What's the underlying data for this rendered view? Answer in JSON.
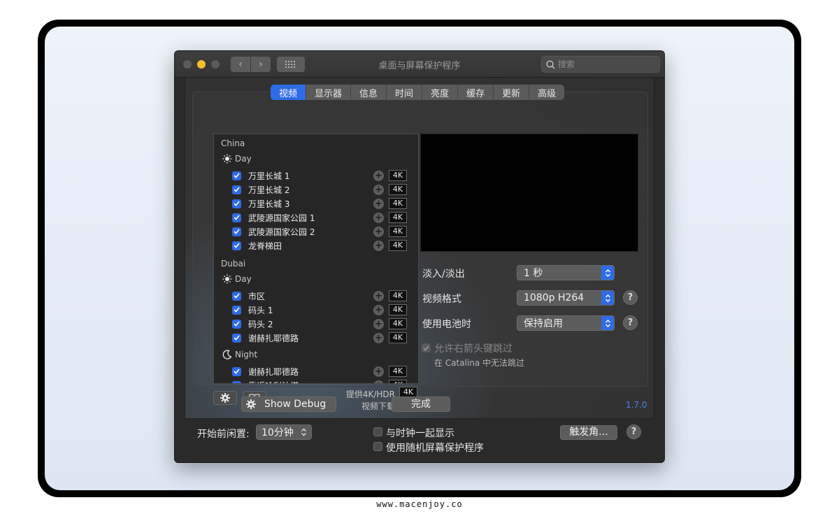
{
  "watermark": "www.macenjoy.co",
  "window": {
    "title": "桌面与屏幕保护程序",
    "nav_back": "‹",
    "nav_forward": "›",
    "search_placeholder": "搜索"
  },
  "tabs": [
    "视频",
    "显示器",
    "信息",
    "时间",
    "亮度",
    "缓存",
    "更新",
    "高级"
  ],
  "active_tab": "视频",
  "video_list": {
    "groups": [
      {
        "city": "China",
        "periods": [
          {
            "period": "Day",
            "items": [
              "万里长城 1",
              "万里长城 2",
              "万里长城 3",
              "武陵源国家公园 1",
              "武陵源国家公园 2",
              "龙脊梯田"
            ]
          }
        ]
      },
      {
        "city": "Dubai",
        "periods": [
          {
            "period": "Day",
            "items": [
              "市区",
              "码头 1",
              "码头 2",
              "谢赫扎耶德路"
            ]
          },
          {
            "period": "Night",
            "items": [
              "谢赫扎耶德路",
              "靠近哈利法塔"
            ]
          }
        ]
      }
    ],
    "badge": "4K"
  },
  "provide_4k_line1": "提供4K/HDR",
  "provide_4k_line2": "视频下载",
  "provide_4k_badge": "4K",
  "settings": {
    "fade_label": "淡入/淡出",
    "fade_value": "1 秒",
    "format_label": "视频格式",
    "format_value": "1080p H264",
    "battery_label": "使用电池时",
    "battery_value": "保持启用",
    "help": "?",
    "skip_label": "允许右箭头键跳过",
    "skip_note": "在 Catalina 中无法跳过"
  },
  "footer": {
    "debug_label": "Show Debug",
    "done_label": "完成",
    "version": "1.7.0"
  },
  "bottom": {
    "idle_label": "开始前闲置:",
    "idle_value": "10分钟",
    "clock_label": "与时钟一起显示",
    "random_label": "使用随机屏幕保护程序",
    "hot_corners": "触发角...",
    "help": "?"
  },
  "colors": {
    "accent": "#2e6be6",
    "version": "#4a86e8",
    "traffic_min": "#f4bf2f"
  }
}
